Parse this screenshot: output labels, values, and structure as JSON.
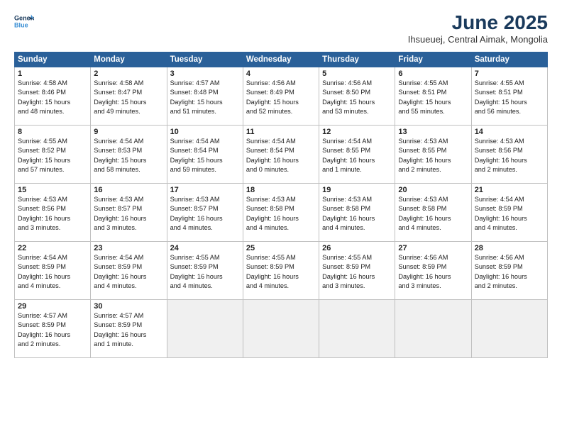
{
  "header": {
    "logo_line1": "General",
    "logo_line2": "Blue",
    "main_title": "June 2025",
    "sub_title": "Ihsueuej, Central Aimak, Mongolia"
  },
  "calendar": {
    "headers": [
      "Sunday",
      "Monday",
      "Tuesday",
      "Wednesday",
      "Thursday",
      "Friday",
      "Saturday"
    ],
    "weeks": [
      [
        {
          "day": "",
          "info": ""
        },
        {
          "day": "2",
          "info": "Sunrise: 4:58 AM\nSunset: 8:47 PM\nDaylight: 15 hours\nand 49 minutes."
        },
        {
          "day": "3",
          "info": "Sunrise: 4:57 AM\nSunset: 8:48 PM\nDaylight: 15 hours\nand 51 minutes."
        },
        {
          "day": "4",
          "info": "Sunrise: 4:56 AM\nSunset: 8:49 PM\nDaylight: 15 hours\nand 52 minutes."
        },
        {
          "day": "5",
          "info": "Sunrise: 4:56 AM\nSunset: 8:50 PM\nDaylight: 15 hours\nand 53 minutes."
        },
        {
          "day": "6",
          "info": "Sunrise: 4:55 AM\nSunset: 8:51 PM\nDaylight: 15 hours\nand 55 minutes."
        },
        {
          "day": "7",
          "info": "Sunrise: 4:55 AM\nSunset: 8:51 PM\nDaylight: 15 hours\nand 56 minutes."
        }
      ],
      [
        {
          "day": "8",
          "info": "Sunrise: 4:55 AM\nSunset: 8:52 PM\nDaylight: 15 hours\nand 57 minutes."
        },
        {
          "day": "9",
          "info": "Sunrise: 4:54 AM\nSunset: 8:53 PM\nDaylight: 15 hours\nand 58 minutes."
        },
        {
          "day": "10",
          "info": "Sunrise: 4:54 AM\nSunset: 8:54 PM\nDaylight: 15 hours\nand 59 minutes."
        },
        {
          "day": "11",
          "info": "Sunrise: 4:54 AM\nSunset: 8:54 PM\nDaylight: 16 hours\nand 0 minutes."
        },
        {
          "day": "12",
          "info": "Sunrise: 4:54 AM\nSunset: 8:55 PM\nDaylight: 16 hours\nand 1 minute."
        },
        {
          "day": "13",
          "info": "Sunrise: 4:53 AM\nSunset: 8:55 PM\nDaylight: 16 hours\nand 2 minutes."
        },
        {
          "day": "14",
          "info": "Sunrise: 4:53 AM\nSunset: 8:56 PM\nDaylight: 16 hours\nand 2 minutes."
        }
      ],
      [
        {
          "day": "15",
          "info": "Sunrise: 4:53 AM\nSunset: 8:56 PM\nDaylight: 16 hours\nand 3 minutes."
        },
        {
          "day": "16",
          "info": "Sunrise: 4:53 AM\nSunset: 8:57 PM\nDaylight: 16 hours\nand 3 minutes."
        },
        {
          "day": "17",
          "info": "Sunrise: 4:53 AM\nSunset: 8:57 PM\nDaylight: 16 hours\nand 4 minutes."
        },
        {
          "day": "18",
          "info": "Sunrise: 4:53 AM\nSunset: 8:58 PM\nDaylight: 16 hours\nand 4 minutes."
        },
        {
          "day": "19",
          "info": "Sunrise: 4:53 AM\nSunset: 8:58 PM\nDaylight: 16 hours\nand 4 minutes."
        },
        {
          "day": "20",
          "info": "Sunrise: 4:53 AM\nSunset: 8:58 PM\nDaylight: 16 hours\nand 4 minutes."
        },
        {
          "day": "21",
          "info": "Sunrise: 4:54 AM\nSunset: 8:59 PM\nDaylight: 16 hours\nand 4 minutes."
        }
      ],
      [
        {
          "day": "22",
          "info": "Sunrise: 4:54 AM\nSunset: 8:59 PM\nDaylight: 16 hours\nand 4 minutes."
        },
        {
          "day": "23",
          "info": "Sunrise: 4:54 AM\nSunset: 8:59 PM\nDaylight: 16 hours\nand 4 minutes."
        },
        {
          "day": "24",
          "info": "Sunrise: 4:55 AM\nSunset: 8:59 PM\nDaylight: 16 hours\nand 4 minutes."
        },
        {
          "day": "25",
          "info": "Sunrise: 4:55 AM\nSunset: 8:59 PM\nDaylight: 16 hours\nand 4 minutes."
        },
        {
          "day": "26",
          "info": "Sunrise: 4:55 AM\nSunset: 8:59 PM\nDaylight: 16 hours\nand 3 minutes."
        },
        {
          "day": "27",
          "info": "Sunrise: 4:56 AM\nSunset: 8:59 PM\nDaylight: 16 hours\nand 3 minutes."
        },
        {
          "day": "28",
          "info": "Sunrise: 4:56 AM\nSunset: 8:59 PM\nDaylight: 16 hours\nand 2 minutes."
        }
      ],
      [
        {
          "day": "29",
          "info": "Sunrise: 4:57 AM\nSunset: 8:59 PM\nDaylight: 16 hours\nand 2 minutes."
        },
        {
          "day": "30",
          "info": "Sunrise: 4:57 AM\nSunset: 8:59 PM\nDaylight: 16 hours\nand 1 minute."
        },
        {
          "day": "",
          "info": ""
        },
        {
          "day": "",
          "info": ""
        },
        {
          "day": "",
          "info": ""
        },
        {
          "day": "",
          "info": ""
        },
        {
          "day": "",
          "info": ""
        }
      ]
    ],
    "week0_day1": {
      "day": "1",
      "info": "Sunrise: 4:58 AM\nSunset: 8:46 PM\nDaylight: 15 hours\nand 48 minutes."
    }
  }
}
